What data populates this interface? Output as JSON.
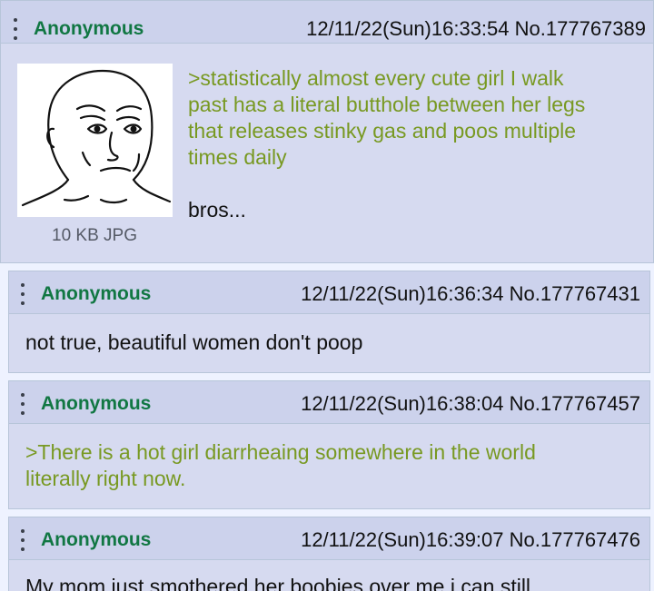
{
  "posts": [
    {
      "name": "Anonymous",
      "datetime": "12/11/22(Sun)16:33:54",
      "post_no": "No.177767389",
      "file_info": "10 KB JPG",
      "lines": [
        ">statistically almost every cute girl I walk",
        "past has a literal butthole between her legs",
        "that releases stinky gas and poos multiple",
        "times daily"
      ],
      "after": "bros..."
    },
    {
      "name": "Anonymous",
      "datetime": "12/11/22(Sun)16:36:34",
      "post_no": "No.177767431",
      "lines": [
        "not true, beautiful women don't poop"
      ]
    },
    {
      "name": "Anonymous",
      "datetime": "12/11/22(Sun)16:38:04",
      "post_no": "No.177767457",
      "lines": [
        ">There is a hot girl diarrheaing somewhere in the world",
        "literally right now."
      ]
    },
    {
      "name": "Anonymous",
      "datetime": "12/11/22(Sun)16:39:07",
      "post_no": "No.177767476",
      "lines": [
        "My mom just smothered her boobies over me i can still"
      ]
    }
  ],
  "colors": {
    "name": "#117743",
    "greentext": "#789922",
    "post_bg": "#d6daf0",
    "header_bg": "#ccd2ec",
    "page_bg": "#eef2ff"
  },
  "icons": {
    "menu": "vertical-ellipsis",
    "thumbnail": "wojak-face-drawing"
  }
}
